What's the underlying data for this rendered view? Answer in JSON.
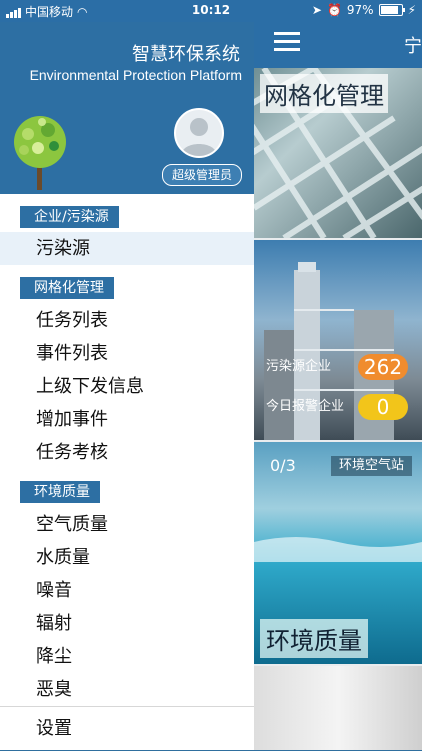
{
  "status": {
    "carrier": "中国移动",
    "time": "10:12",
    "battery": "97%"
  },
  "sidebar": {
    "title": "智慧环保系统",
    "subtitle": "Environmental Protection Platform",
    "role": "超级管理员",
    "sections": [
      {
        "label": "企业/污染源",
        "items": [
          "污染源"
        ]
      },
      {
        "label": "网格化管理",
        "items": [
          "任务列表",
          "事件列表",
          "上级下发信息",
          "增加事件",
          "任务考核"
        ]
      },
      {
        "label": "环境质量",
        "items": [
          "空气质量",
          "水质量",
          "噪音",
          "辐射",
          "降尘",
          "恶臭"
        ]
      }
    ],
    "settings": "设置"
  },
  "main": {
    "header_char": "宁",
    "card1_title": "网格化管理",
    "stat1_label": "污染源企业",
    "stat1_value": "262",
    "stat2_label": "今日报警企业",
    "stat2_value": "0",
    "air_counter": "0/3",
    "air_label": "环境空气站",
    "card3_title": "环境质量"
  }
}
